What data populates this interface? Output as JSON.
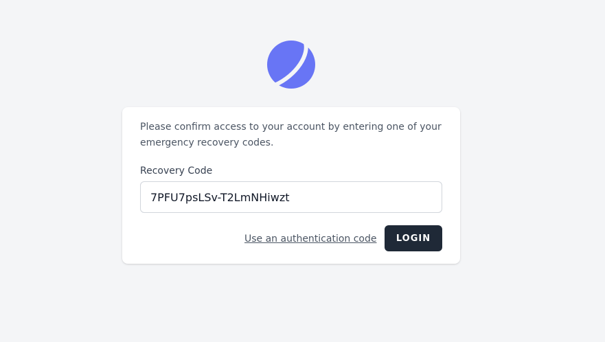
{
  "branding": {
    "logo_icon": "planet-logo-icon",
    "logo_color": "#6875f5"
  },
  "form": {
    "message": "Please confirm access to your account by entering one of your emergency recovery codes.",
    "recovery_label": "Recovery Code",
    "recovery_value": "7PFU7psLSv-T2LmNHiwzt",
    "alt_link_label": "Use an authentication code",
    "submit_label": "LOGIN"
  }
}
